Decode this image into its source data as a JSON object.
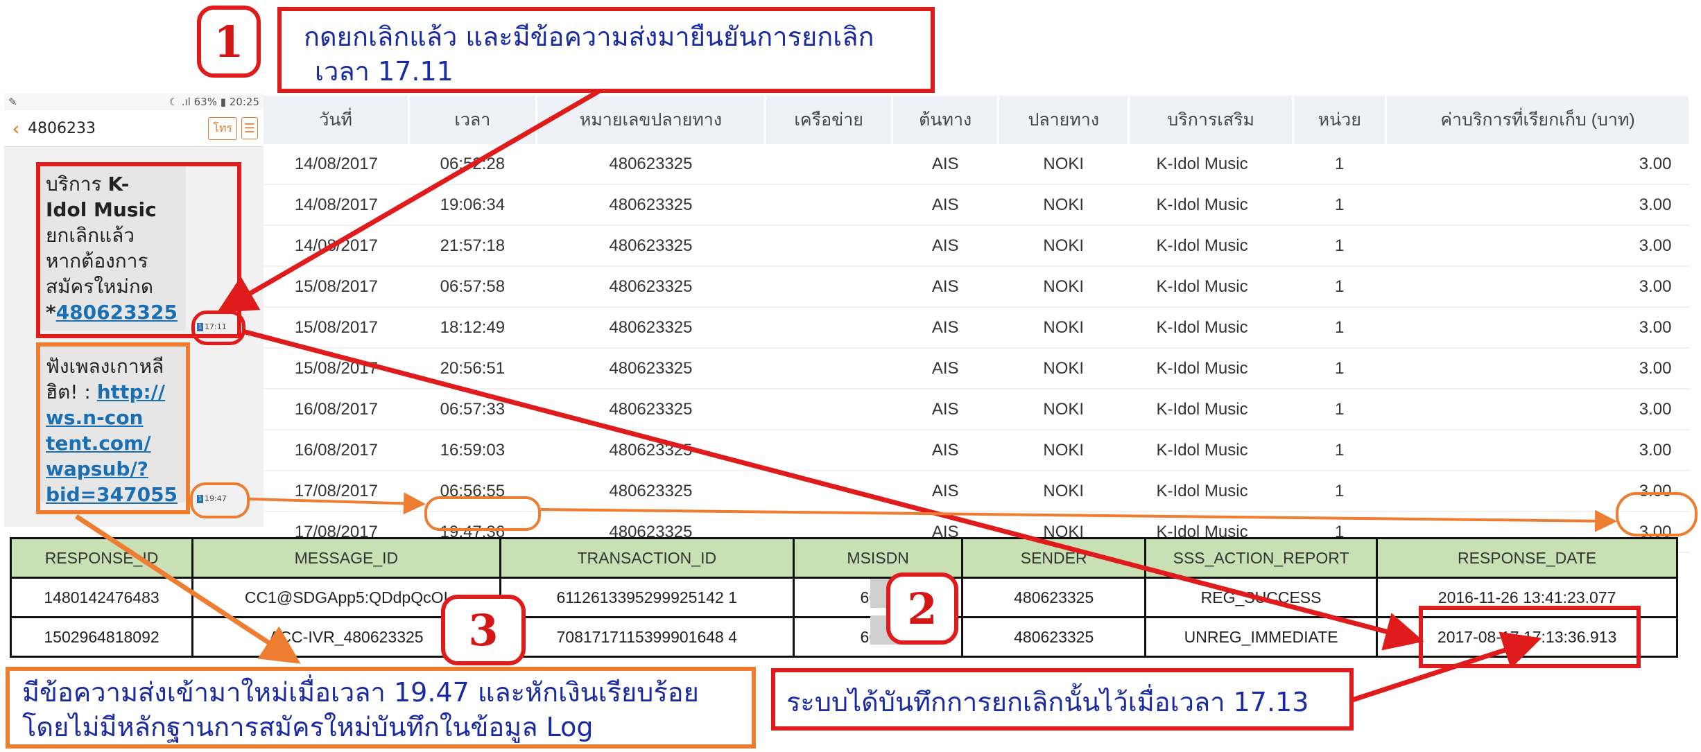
{
  "phone": {
    "status_left": "✎",
    "status_right": "☾ .ıl 63% ▮ 20:25",
    "number": "4806233",
    "call_label": "โทร",
    "messages": [
      {
        "time": "17:11",
        "prefix": "บริการ ",
        "bold1": "K-",
        "bold2": "Idol Music",
        "line3": "ยกเลิกแล้ว",
        "line4": "หากต้องการ",
        "line5": "สมัครใหม่กด",
        "star": "*",
        "link": "480623325"
      },
      {
        "time": "19:47",
        "line1": "ฟังเพลงเกาหลี",
        "line2_prefix": "ฮิต! : ",
        "link_lines": [
          "http://",
          "ws.n-con",
          "tent.com/",
          "wapsub/?",
          "bid=347055"
        ]
      }
    ]
  },
  "billing_table": {
    "headers": [
      "วันที่",
      "เวลา",
      "หมายเลขปลายทาง",
      "เครือข่าย",
      "ต้นทาง",
      "ปลายทาง",
      "บริการเสริม",
      "หน่วย",
      "ค่าบริการที่เรียกเก็บ (บาท)"
    ],
    "rows": [
      [
        "14/08/2017",
        "06:52:28",
        "480623325",
        "",
        "AIS",
        "NOKI",
        "K-Idol Music",
        "1",
        "3.00"
      ],
      [
        "14/08/2017",
        "19:06:34",
        "480623325",
        "",
        "AIS",
        "NOKI",
        "K-Idol Music",
        "1",
        "3.00"
      ],
      [
        "14/08/2017",
        "21:57:18",
        "480623325",
        "",
        "AIS",
        "NOKI",
        "K-Idol Music",
        "1",
        "3.00"
      ],
      [
        "15/08/2017",
        "06:57:58",
        "480623325",
        "",
        "AIS",
        "NOKI",
        "K-Idol Music",
        "1",
        "3.00"
      ],
      [
        "15/08/2017",
        "18:12:49",
        "480623325",
        "",
        "AIS",
        "NOKI",
        "K-Idol Music",
        "1",
        "3.00"
      ],
      [
        "15/08/2017",
        "20:56:51",
        "480623325",
        "",
        "AIS",
        "NOKI",
        "K-Idol Music",
        "1",
        "3.00"
      ],
      [
        "16/08/2017",
        "06:57:33",
        "480623325",
        "",
        "AIS",
        "NOKI",
        "K-Idol Music",
        "1",
        "3.00"
      ],
      [
        "16/08/2017",
        "16:59:03",
        "480623325",
        "",
        "AIS",
        "NOKI",
        "K-Idol Music",
        "1",
        "3.00"
      ],
      [
        "17/08/2017",
        "06:56:55",
        "480623325",
        "",
        "AIS",
        "NOKI",
        "K-Idol Music",
        "1",
        "3.00"
      ],
      [
        "17/08/2017",
        "19:47:36",
        "480623325",
        "",
        "AIS",
        "NOKI",
        "K-Idol Music",
        "1",
        "3.00"
      ]
    ]
  },
  "log_table": {
    "headers": [
      "RESPONSE_ID",
      "MESSAGE_ID",
      "TRANSACTION_ID",
      "MSISDN",
      "SENDER",
      "SSS_ACTION_REPORT",
      "RESPONSE_DATE"
    ],
    "rows": [
      [
        "1480142476483",
        "CC1@SDGApp5:QDdpQcOI",
        "6112613395299925142 1",
        "6681",
        "480623325",
        "REG_SUCCESS",
        "2016-11-26 13:41:23.077"
      ],
      [
        "1502964818092",
        "ACC-IVR_480623325",
        "7081717115399901648 4",
        "6681",
        "480623325",
        "UNREG_IMMEDIATE",
        "2017-08-17 17:13:36.913"
      ]
    ]
  },
  "callouts": {
    "c1": {
      "num": "1",
      "line1": "กดยกเลิกแล้ว และมีข้อความส่งมายืนยันการยกเลิก",
      "line2": "เวลา 17.11"
    },
    "c2": {
      "num": "2",
      "text": "ระบบได้บันทึกการยกเลิกนั้นไว้เมื่อเวลา 17.13"
    },
    "c3": {
      "num": "3",
      "line1": "มีข้อความส่งเข้ามาใหม่เมื่อเวลา 19.47 และหักเงินเรียบร้อย",
      "line2": "โดยไม่มีหลักฐานการสมัครใหม่บันทึกในข้อมูล Log"
    }
  },
  "colors": {
    "red": "#e01b1b",
    "orange": "#ed7d31",
    "callout_text": "#1a2aa0",
    "log_header": "#c8e0b4"
  }
}
